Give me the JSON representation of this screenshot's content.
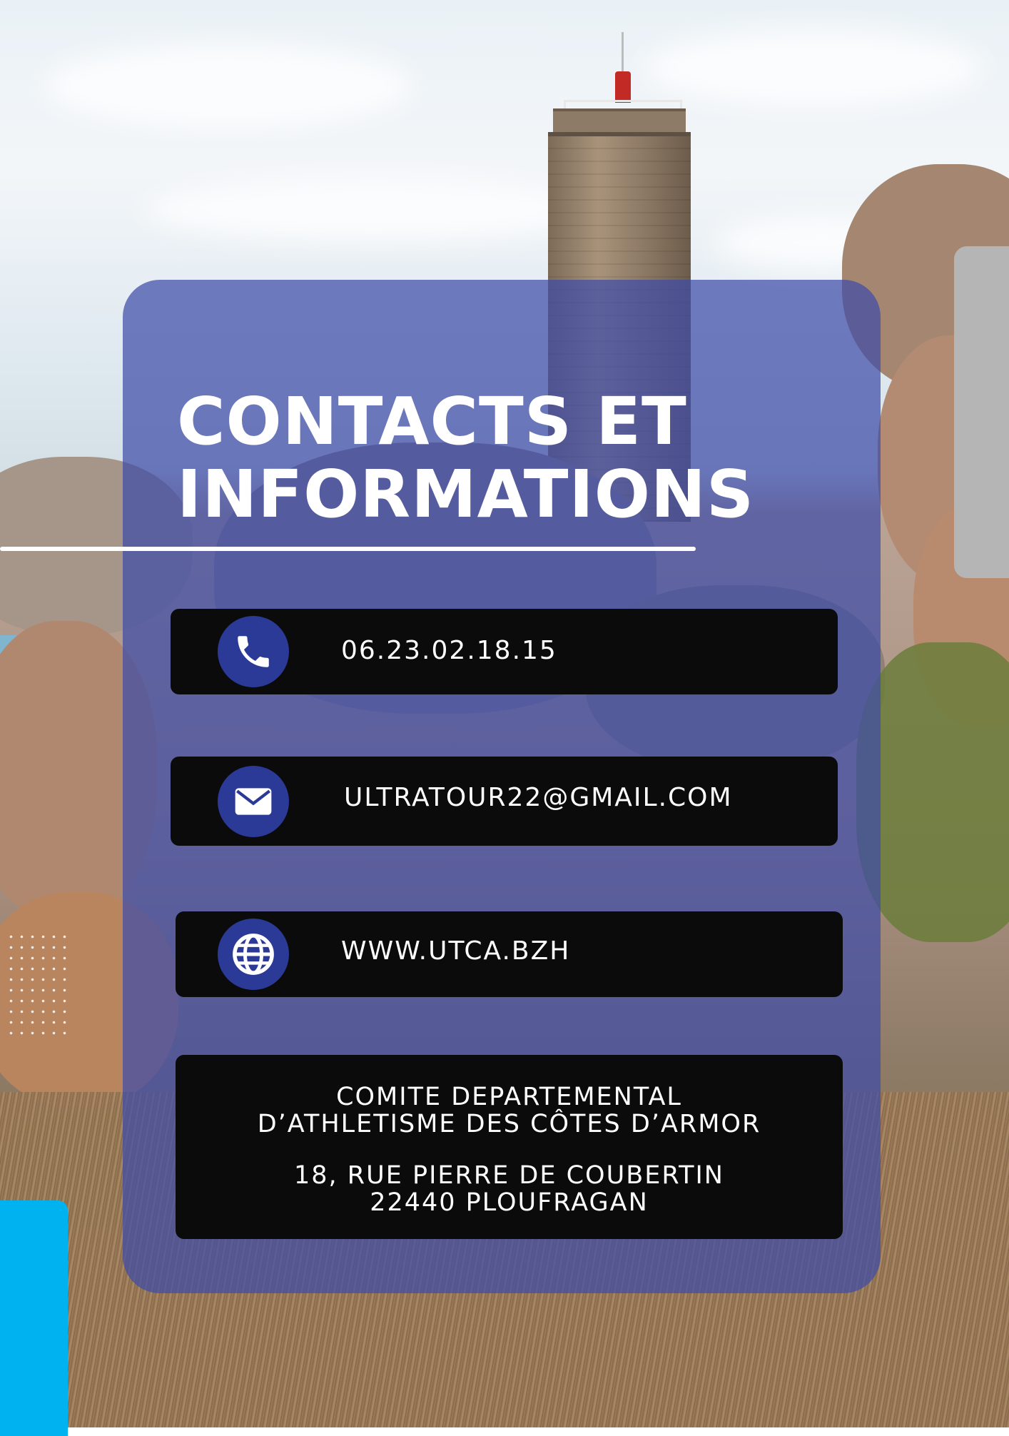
{
  "title": {
    "line1": "CONTACTS ET",
    "line2": "INFORMATIONS"
  },
  "contacts": {
    "phone": {
      "icon": "phone-icon",
      "text": "06.23.02.18.15"
    },
    "email": {
      "icon": "envelope-icon",
      "text": "ULTRATOUR22@GMAIL.COM"
    },
    "website": {
      "icon": "globe-icon",
      "text": "WWW.UTCA.BZH"
    }
  },
  "address": {
    "line1": "COMITE DEPARTEMENTAL",
    "line2": "D’ATHLETISME DES CÔTES D’ARMOR",
    "line3": "18, RUE PIERRE DE COUBERTIN",
    "line4": "22440 PLOUFRAGAN"
  },
  "colors": {
    "card": "#3e4ca8",
    "icon_circle": "#2c3a97",
    "row_background": "#0b0b0c",
    "accent_blue": "#00b2f0",
    "accent_grey": "#b5b5b5"
  }
}
